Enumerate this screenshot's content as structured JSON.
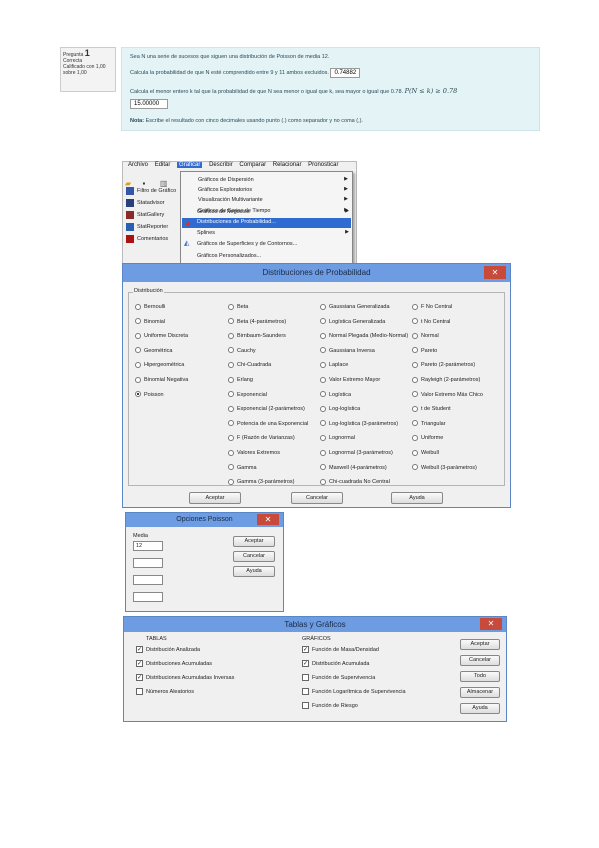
{
  "question": {
    "label": "Pregunta",
    "number": "1",
    "status": "Correcta",
    "score": "Calificado con 1,00 sobre 1,00",
    "line1": "Sea N una serie de sucesos que siguen una distribución de Poisson de media 12.",
    "line2": "Calcula la probabilidad de que N esté comprendido entre 9 y 11 ambos excluidos.",
    "answer1": "0.74882",
    "line3a": "Calcula el menor entero k tal que la probabilidad de que N sea menor o igual que k, sea mayor o igual que 0.78.",
    "formula": "P(N ≤ k) ≥ 0.78",
    "answer2": "15.00000",
    "note_bold": "Nota:",
    "note": "Escribe el resultado con cinco decimales usando punto (.) como separador y no coma (,)."
  },
  "app": {
    "menu": [
      "Archivo",
      "Editar",
      "Graficar",
      "Describir",
      "Comparar",
      "Relacionar",
      "Pronosticar"
    ],
    "side_items": [
      "Filtro de Gráfico",
      "Statadvisor",
      "StatGallery",
      "StatReporter",
      "Comentarios"
    ],
    "dropdown": [
      {
        "label": "Gráficos de Dispersión",
        "arrow": true
      },
      {
        "label": "Gráficos Exploratorios",
        "arrow": true
      },
      {
        "label": "Visualización Multivariante",
        "arrow": true
      },
      {
        "label": "Gráficos de Series de Tiempo",
        "arrow": true
      },
      {
        "label": "Gráficos de Negocios",
        "arrow": true
      },
      {
        "label": "Distribuciones de Probabilidad...",
        "arrow": false,
        "highlight": true
      },
      {
        "label": "Splines",
        "arrow": true
      },
      {
        "label": "Gráficos de Superficies y de Contornos...",
        "arrow": false
      },
      {
        "label": "Gráficos Personalizados...",
        "arrow": false
      }
    ]
  },
  "dist_dialog": {
    "title": "Distribuciones de Probabilidad",
    "close": "✕",
    "group": "Distribución",
    "col1": [
      "Bernoulli",
      "Binomial",
      "Uniforme Discreta",
      "Geométrica",
      "Hipergeométrica",
      "Binomial Negativa",
      "Poisson"
    ],
    "col2": [
      "Beta",
      "Beta (4-parámetros)",
      "Birnbaum-Saunders",
      "Cauchy",
      "Chi-Cuadrada",
      "Erlang",
      "Exponencial",
      "Exponencial (2-parámetros)",
      "Potencia de una Exponencial",
      "F (Razón de Varianzas)",
      "Valores Extremos",
      "Gamma",
      "Gamma (3-parámetros)"
    ],
    "col3": [
      "Gaussiana Generalizada",
      "Logística Generalizada",
      "Normal Plegada (Medio-Normal)",
      "Gaussiana Inversa",
      "Laplace",
      "Valor Extremo Mayor",
      "Logística",
      "Log-logística",
      "Log-logística (3-parámetros)",
      "Lognormal",
      "Lognormal (3-parámetros)",
      "Maxwell (4-parámetros)",
      "Chi-cuadrada No Central"
    ],
    "col4": [
      "F No Central",
      "t No Central",
      "Normal",
      "Pareto",
      "Pareto (2-parámetros)",
      "Rayleigh (2-parámetros)",
      "Valor Extremo Más Chico",
      "t de Student",
      "Triangular",
      "Uniforme",
      "Weibull",
      "Weibull (3-parámetros)"
    ],
    "selected": "Poisson",
    "buttons": [
      "Aceptar",
      "Cancelar",
      "Ayuda"
    ]
  },
  "poisson_dialog": {
    "title": "Opciones Poisson",
    "close": "✕",
    "field_label": "Media",
    "field_value": "12",
    "buttons": [
      "Aceptar",
      "Cancelar",
      "Ayuda"
    ]
  },
  "tables_dialog": {
    "title": "Tablas y Gráficos",
    "close": "✕",
    "tables_header": "TABLAS",
    "graphs_header": "GRÁFICOS",
    "tables": [
      {
        "label": "Distribución Analizada",
        "checked": true
      },
      {
        "label": "Distribuciones Acumuladas",
        "checked": true
      },
      {
        "label": "Distribuciones Acumuladas Inversas",
        "checked": true
      },
      {
        "label": "Números Aleatorios",
        "checked": false
      }
    ],
    "graphs": [
      {
        "label": "Función de Masa/Densidad",
        "checked": true
      },
      {
        "label": "Distribución Acumulada",
        "checked": true
      },
      {
        "label": "Función de Supervivencia",
        "checked": false
      },
      {
        "label": "Función Logarítmica de Supervivencia",
        "checked": false
      },
      {
        "label": "Función de Riesgo",
        "checked": false
      }
    ],
    "buttons": [
      "Aceptar",
      "Cancelar",
      "Todo",
      "Almacenar",
      "Ayuda"
    ]
  }
}
